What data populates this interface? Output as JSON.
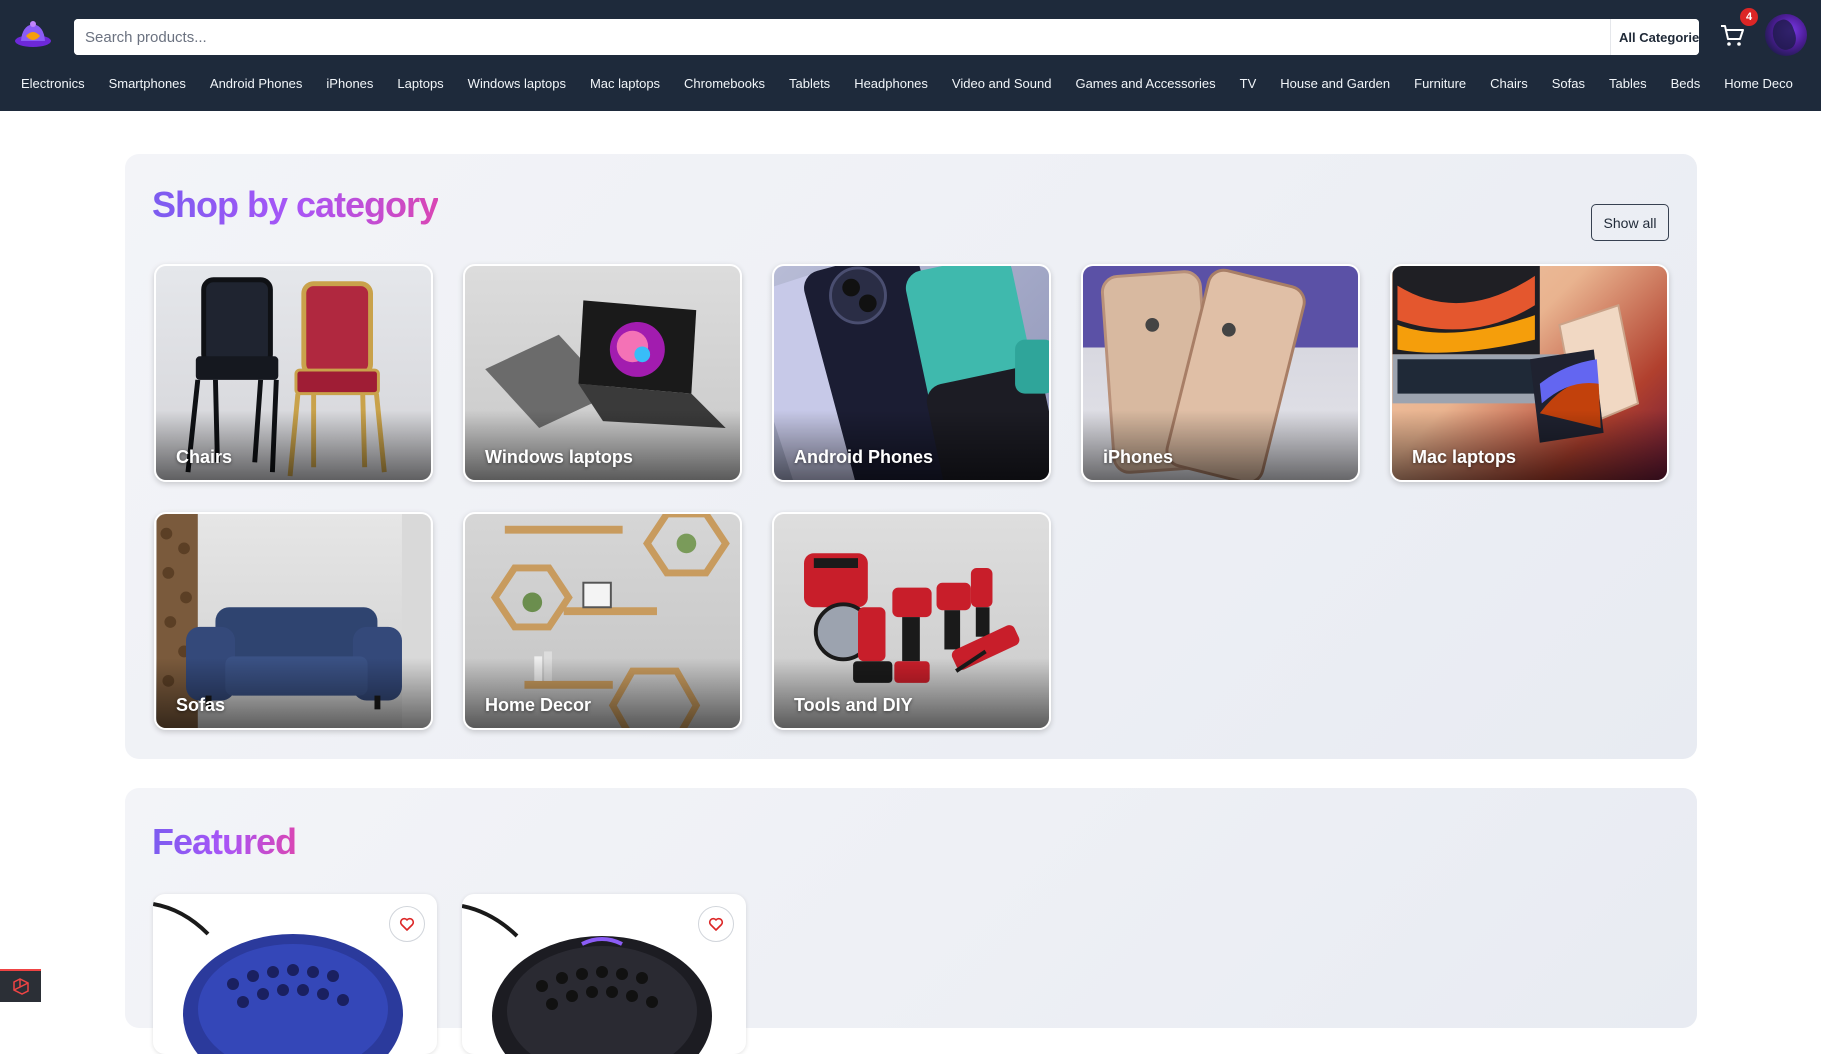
{
  "header": {
    "search_placeholder": "Search products...",
    "category_select": "All Categories",
    "cart_count": "4",
    "brand_colors": {
      "bar": "#1e2a3b",
      "search_button": "#f59e0b",
      "badge": "#dc2626"
    }
  },
  "nav": {
    "items": [
      "Electronics",
      "Smartphones",
      "Android Phones",
      "iPhones",
      "Laptops",
      "Windows laptops",
      "Mac laptops",
      "Chromebooks",
      "Tablets",
      "Headphones",
      "Video and Sound",
      "Games and Accessories",
      "TV",
      "House and Garden",
      "Furniture",
      "Chairs",
      "Sofas",
      "Tables",
      "Beds",
      "Home Deco"
    ]
  },
  "shop": {
    "title": "Shop by category",
    "show_all": "Show all",
    "categories": [
      {
        "label": "Chairs",
        "icon": "chairs-image"
      },
      {
        "label": "Windows laptops",
        "icon": "windows-laptop-image"
      },
      {
        "label": "Android Phones",
        "icon": "android-phones-image"
      },
      {
        "label": "iPhones",
        "icon": "iphones-image"
      },
      {
        "label": "Mac laptops",
        "icon": "mac-laptops-image"
      },
      {
        "label": "Sofas",
        "icon": "sofa-image"
      },
      {
        "label": "Home Decor",
        "icon": "home-decor-image"
      },
      {
        "label": "Tools and DIY",
        "icon": "power-tools-image"
      }
    ]
  },
  "featured": {
    "title": "Featured",
    "products": [
      {
        "icon": "blue-gaming-mouse-image"
      },
      {
        "icon": "black-gaming-mouse-image"
      }
    ]
  }
}
